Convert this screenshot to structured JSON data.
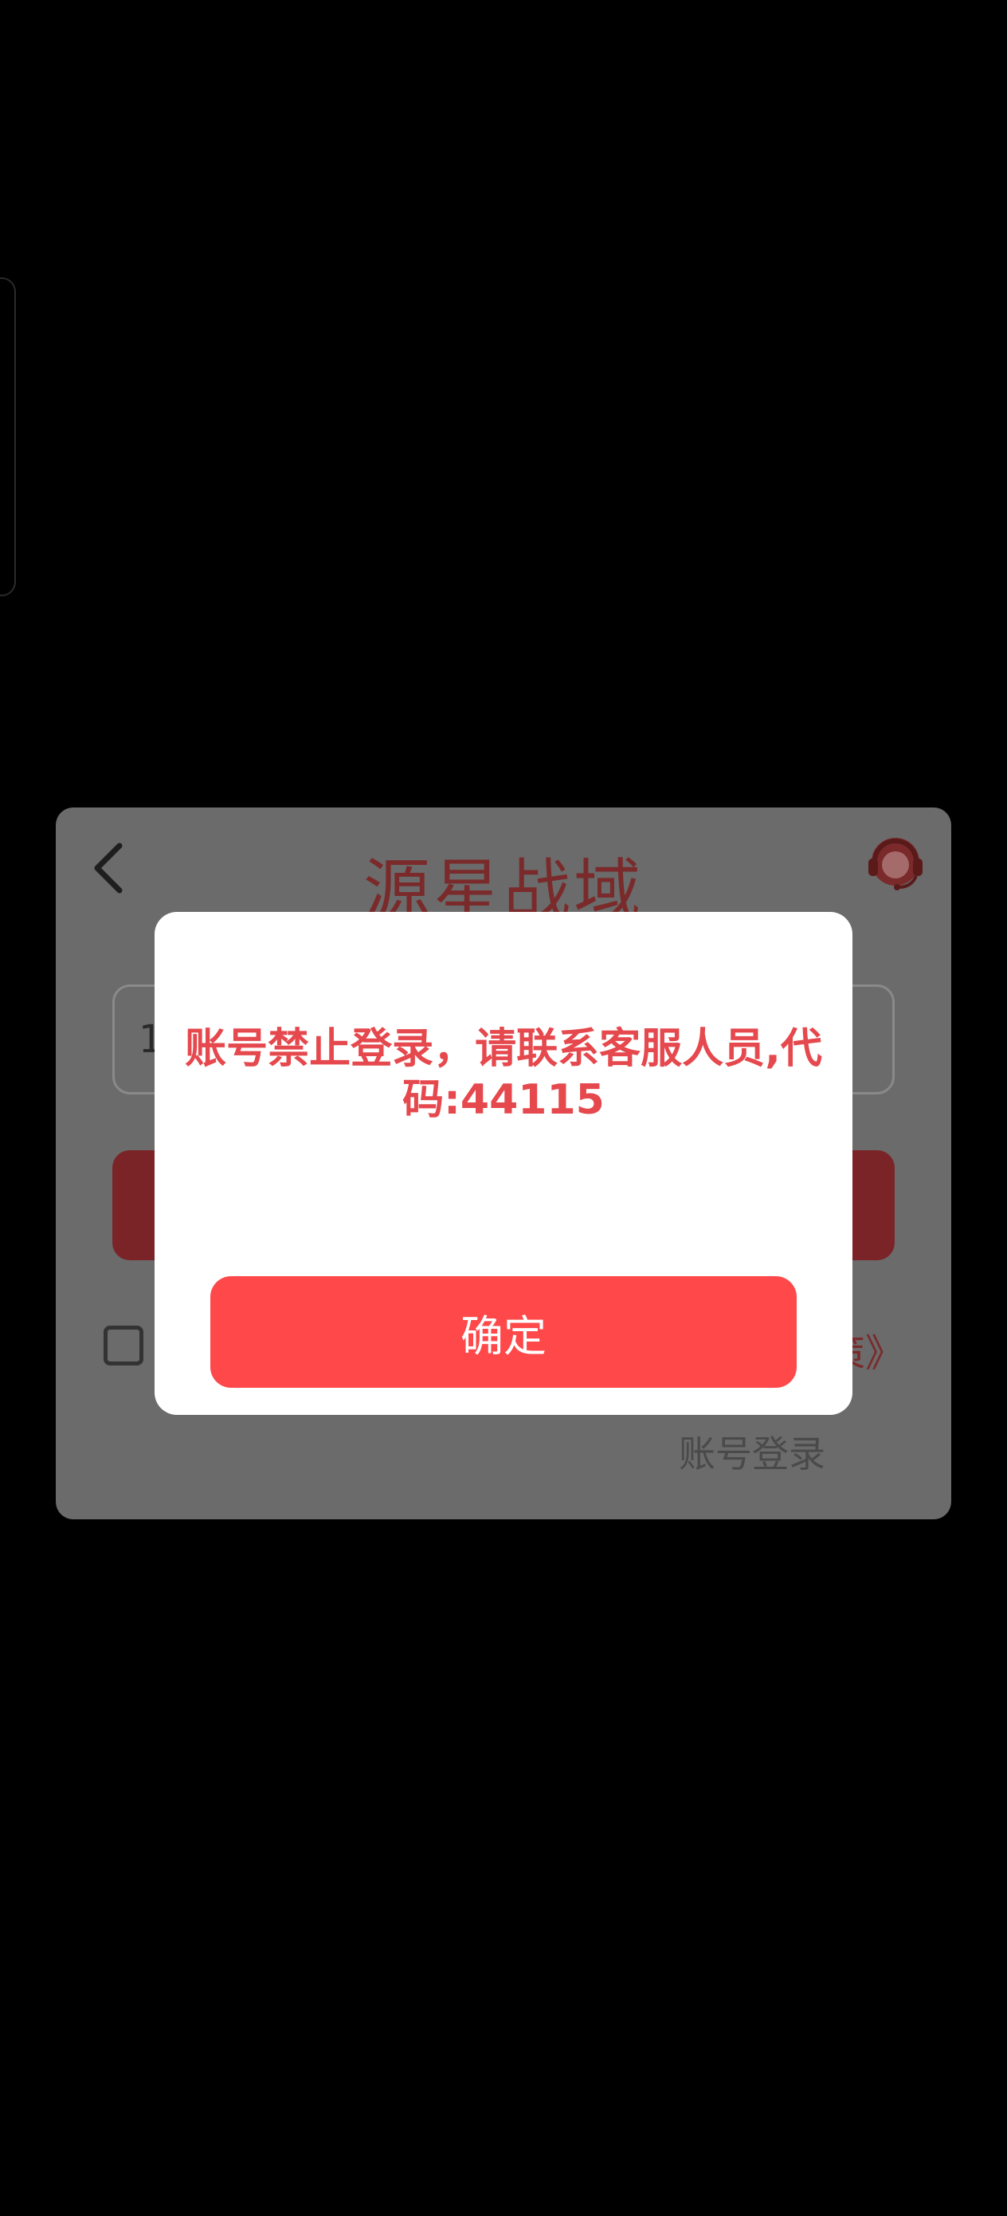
{
  "app": {
    "title": "源星战域"
  },
  "login": {
    "phone_value": "1",
    "privacy_text": "策》",
    "account_login": "账号登录"
  },
  "dialog": {
    "message": "账号禁止登录，请联系客服人员,代码:44115",
    "confirm_label": "确定"
  },
  "icons": {
    "back": "back-arrow-icon",
    "support": "customer-service-icon"
  },
  "colors": {
    "accent": "#fe4849",
    "message": "#e5484d",
    "overlay_panel": "#6b6b6b"
  }
}
